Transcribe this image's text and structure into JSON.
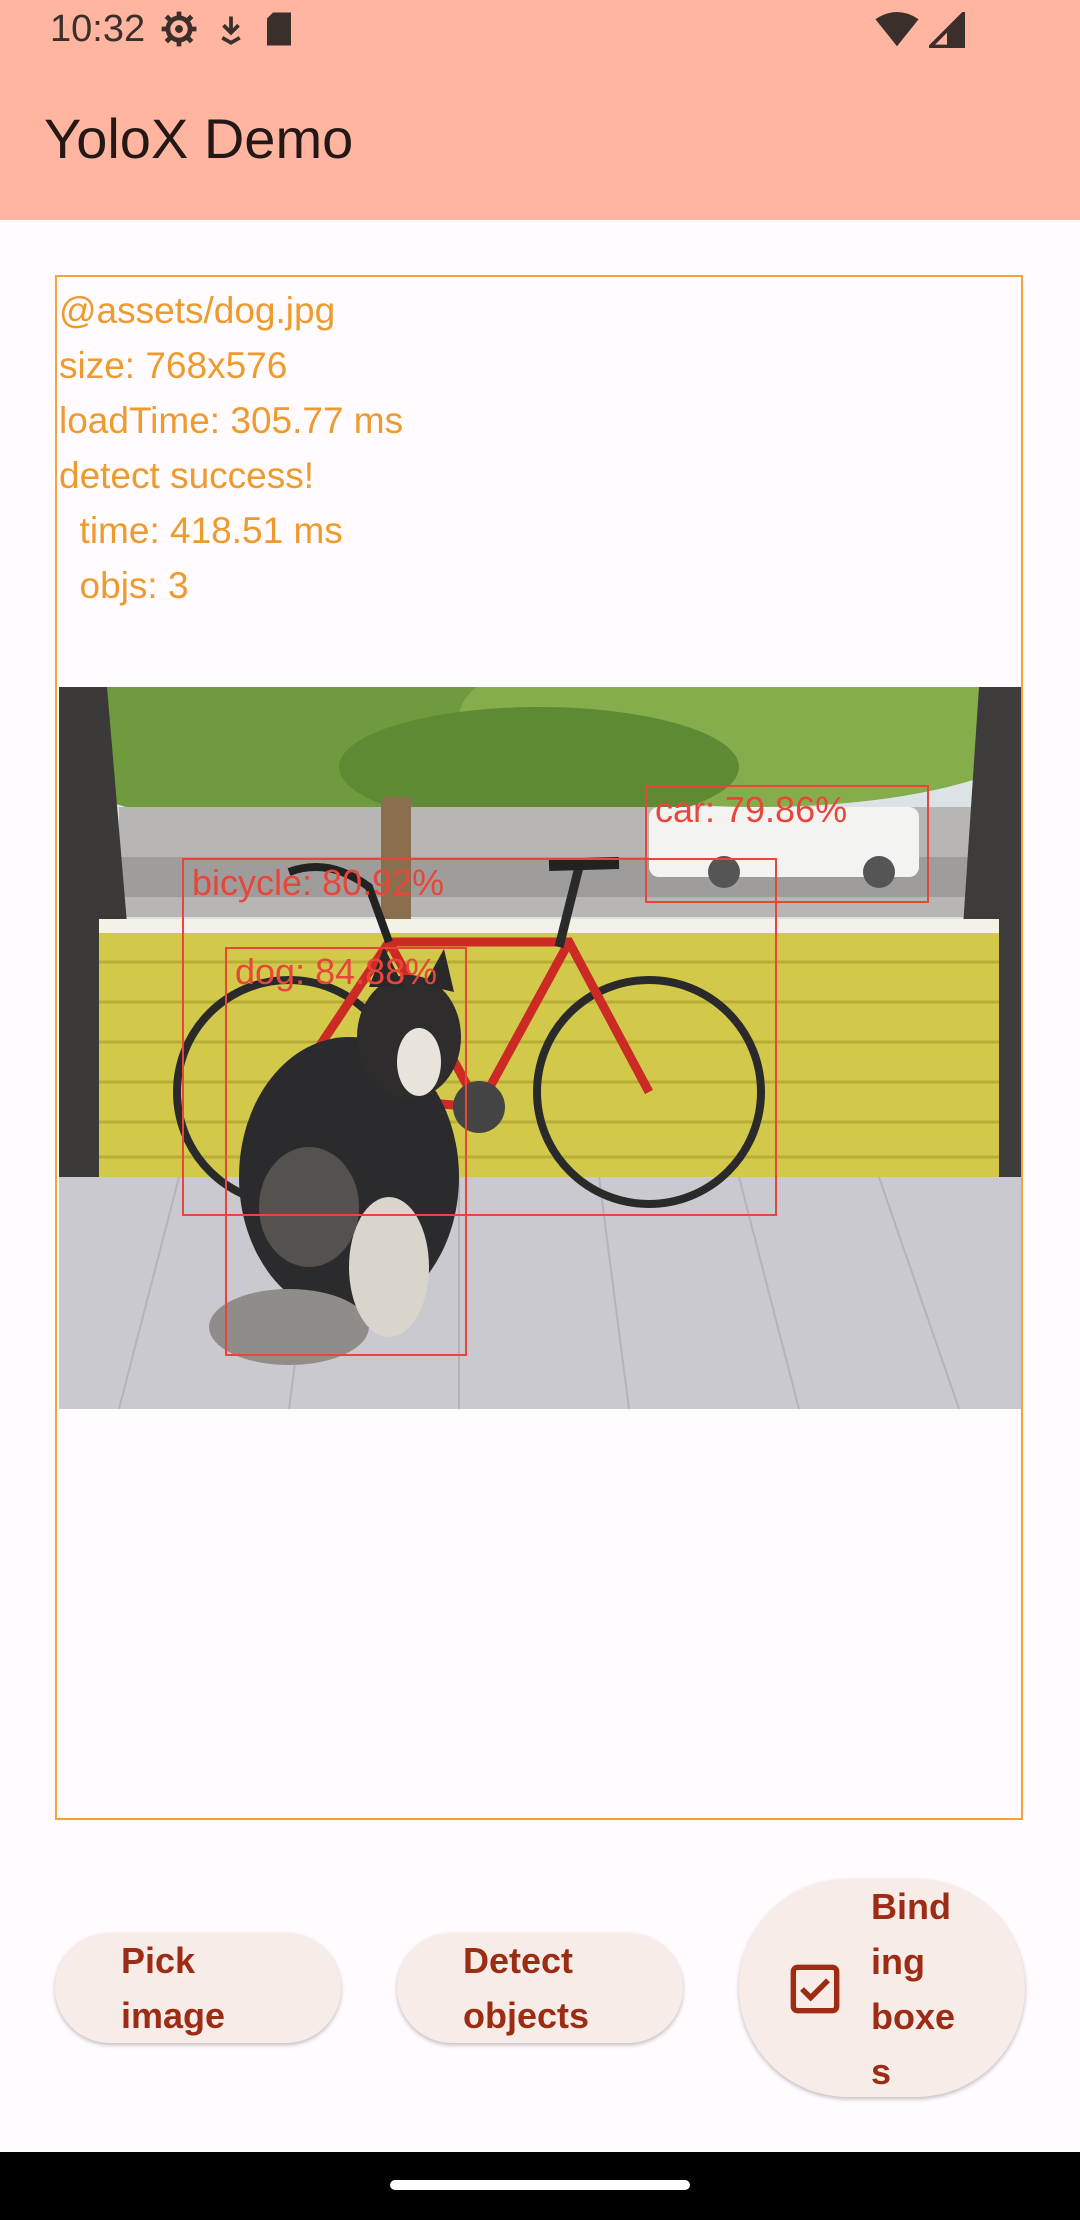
{
  "status_bar": {
    "time": "10:32",
    "left_icons": [
      "settings-icon",
      "download-icon",
      "sd-card-icon"
    ],
    "right_icons": [
      "wifi-icon",
      "cellular-signal-icon"
    ]
  },
  "app_bar": {
    "title": "YoloX Demo"
  },
  "result": {
    "image_source": "@assets/dog.jpg",
    "size": "size: 768x576",
    "load_time": "loadTime: 305.77 ms",
    "status": "detect success!",
    "time": "  time: 418.51 ms",
    "objs": "  objs: 3"
  },
  "detections": [
    {
      "label": "car: 79.86%"
    },
    {
      "label": "bicycle: 80.92%"
    },
    {
      "label": "dog: 84.88%"
    }
  ],
  "buttons": {
    "pick_image": [
      "Pick",
      "image"
    ],
    "detect_objects": [
      "Detect",
      "objects"
    ],
    "binding_boxes": [
      "Bind",
      "ing",
      "boxe",
      "s"
    ],
    "binding_boxes_checked": true
  },
  "colors": {
    "app_bar": "#ffb5a0",
    "info_text": "#ee9a2d",
    "bbox": "#e8463a",
    "button_text": "#9c2c13"
  }
}
